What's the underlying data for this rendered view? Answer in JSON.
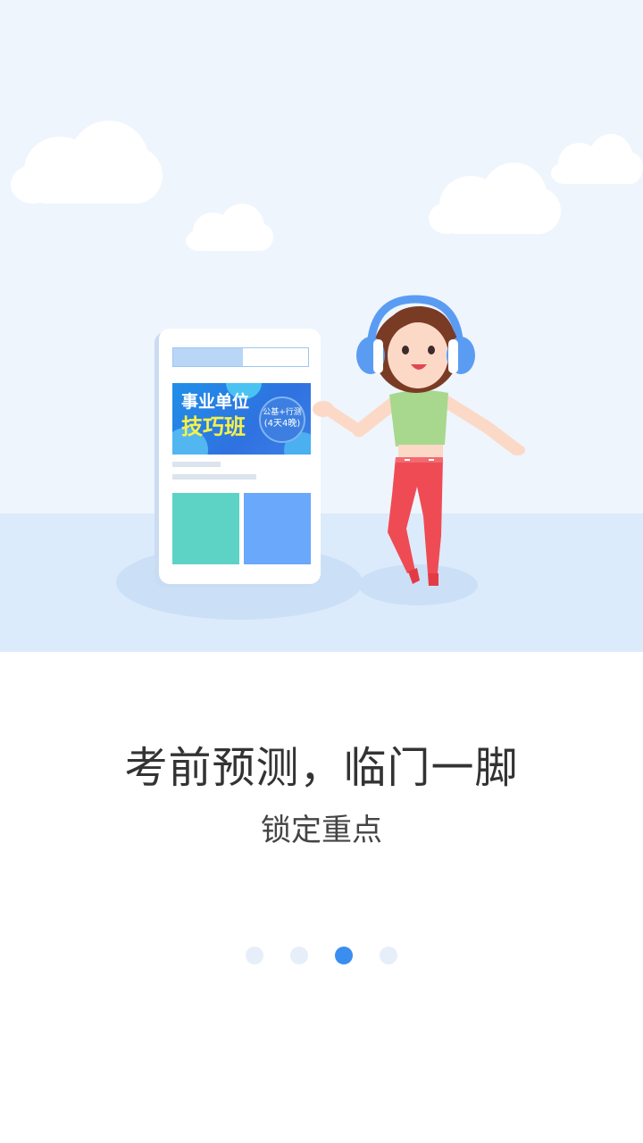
{
  "banner": {
    "line1": "事业单位",
    "line2": "技巧班",
    "badge_line1": "公基+行测",
    "badge_line2": "(4天4晚)"
  },
  "slide": {
    "headline": "考前预测，临门一脚",
    "subhead": "锁定重点"
  },
  "pager": {
    "count": 4,
    "active_index": 2
  },
  "colors": {
    "sky": "#eef5fd",
    "floor": "#dcebfb",
    "accent": "#3a8ef0",
    "dot_inactive": "#e6eff9",
    "text": "#333333"
  },
  "icons": [
    "cloud-icon",
    "phone-illustration",
    "girl-with-headphones-illustration"
  ]
}
